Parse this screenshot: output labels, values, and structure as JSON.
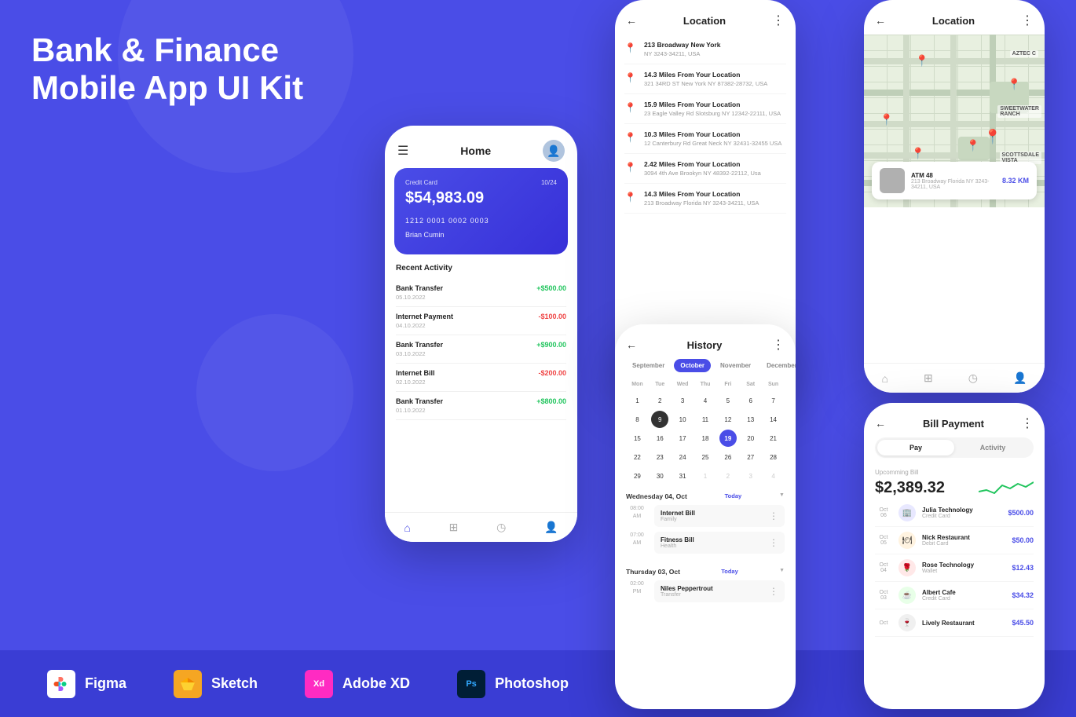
{
  "hero": {
    "line1": "Bank & Finance",
    "line2": "Mobile App UI Kit"
  },
  "tools": [
    {
      "name": "Figma",
      "icon": "figma"
    },
    {
      "name": "Sketch",
      "icon": "sketch"
    },
    {
      "name": "Adobe XD",
      "icon": "xd"
    },
    {
      "name": "Photoshop",
      "icon": "ps"
    }
  ],
  "phone_home": {
    "title": "Home",
    "card": {
      "label": "Credit Card",
      "expiry": "10/24",
      "amount": "$54,983.09",
      "numbers": "1212    0001    0002    0003",
      "name": "Brian Cumin"
    },
    "recent_label": "Recent Activity",
    "activities": [
      {
        "name": "Bank Transfer",
        "date": "05.10.2022",
        "amount": "+$500.00",
        "positive": true
      },
      {
        "name": "Internet Payment",
        "date": "04.10.2022",
        "amount": "-$100.00",
        "positive": false
      },
      {
        "name": "Bank Transfer",
        "date": "03.10.2022",
        "amount": "+$900.00",
        "positive": true
      },
      {
        "name": "Internet Bill",
        "date": "02.10.2022",
        "amount": "-$200.00",
        "positive": false
      },
      {
        "name": "Bank Transfer",
        "date": "01.10.2022",
        "amount": "+$800.00",
        "positive": true
      }
    ]
  },
  "phone_location": {
    "title": "Location",
    "locations": [
      {
        "distance": "213 Broadway New York",
        "address": "NY 3243-34211, USA"
      },
      {
        "distance": "14.3 Miles From Your Location",
        "address": "321 34RD ST New York\nNY 87382-28732, USA"
      },
      {
        "distance": "15.9 Miles From Your Location",
        "address": "23 Eagle Valley Rd Slotsburg\nNY 12342-22111, USA"
      },
      {
        "distance": "10.3 Miles From Your Location",
        "address": "12 Canterbury Rd Great Neck\nNY 32431-32455 USA"
      },
      {
        "distance": "2.42 Miles From Your Location",
        "address": "3094 4th Ave Brookyn\nNY 48392-22112, Usa"
      },
      {
        "distance": "14.3 Miles From Your Location",
        "address": "213 Broadway Florida\nNY 3243-34211, USA"
      }
    ]
  },
  "phone_map": {
    "title": "Location",
    "atm": {
      "name": "ATM 48",
      "address": "213 Broadway Florida\nNY 3243-34211, USA",
      "distance": "8.32 KM"
    },
    "labels": [
      "AZTEC C",
      "SWEETWATER RANCH",
      "SCOTTSDALE VISTA"
    ]
  },
  "phone_history": {
    "title": "History",
    "months": [
      "September",
      "October",
      "November",
      "December"
    ],
    "active_month": "October",
    "days": [
      "Mon",
      "Tue",
      "Wed",
      "Thu",
      "Fri",
      "Sat",
      "Sun"
    ],
    "weeks": [
      [
        1,
        2,
        3,
        4,
        5,
        6,
        7
      ],
      [
        8,
        9,
        10,
        11,
        12,
        13,
        14
      ],
      [
        15,
        16,
        17,
        18,
        19,
        20,
        21
      ],
      [
        22,
        23,
        24,
        25,
        26,
        27,
        28
      ],
      [
        29,
        30,
        31,
        1,
        2,
        3,
        4
      ]
    ],
    "selected_day": 9,
    "today_day": 19,
    "groups": [
      {
        "label": "Wednesday 04, Oct",
        "tag": "Today",
        "events": [
          {
            "time": "08:00\nAM",
            "name": "Internet Bill",
            "cat": "Family"
          },
          {
            "time": "07:00\nAM",
            "name": "Fitness Bill",
            "cat": "Health"
          }
        ]
      },
      {
        "label": "Thursday 03, Oct",
        "tag": "Today",
        "events": [
          {
            "time": "02:00\nPM",
            "name": "Niles Peppertrout",
            "cat": "Transfer"
          }
        ]
      }
    ]
  },
  "phone_bill": {
    "title": "Bill Payment",
    "tabs": [
      "Pay",
      "Activity"
    ],
    "active_tab": "Pay",
    "upcoming_label": "Upcomming Bill",
    "amount": "$2,389.32",
    "items": [
      {
        "oct": "Oct\n06",
        "name": "Julia Technology",
        "type": "Credit Card",
        "amount": "$500.00",
        "color": "#4a4de7"
      },
      {
        "oct": "Oct\n05",
        "name": "Nick Restaurant",
        "type": "Debit Card",
        "amount": "$50.00",
        "color": "#f5a623"
      },
      {
        "oct": "Oct\n04",
        "name": "Rose Technology",
        "type": "Wallet",
        "amount": "$12.43",
        "color": "#ef4444"
      },
      {
        "oct": "Oct\n03",
        "name": "Albert Cafe",
        "type": "Credit Card",
        "amount": "$34.32",
        "color": "#22c55e"
      },
      {
        "oct": "Oct",
        "name": "Lively Restaurant",
        "type": "",
        "amount": "$45.50",
        "color": "#888"
      }
    ]
  }
}
